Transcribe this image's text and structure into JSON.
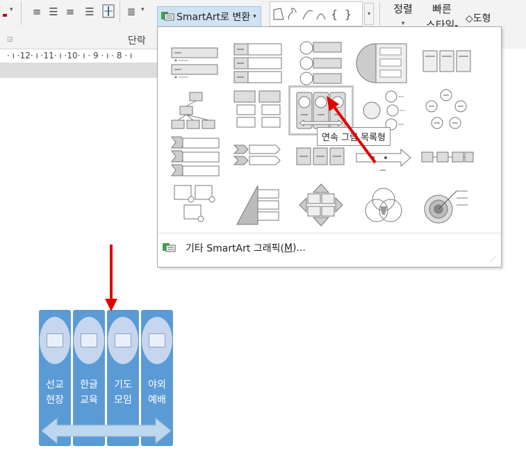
{
  "ribbon": {
    "convert_smartart_label": "SmartArt로 변환",
    "paragraph_group_label": "단락",
    "arrange_label": "정렬",
    "quick_styles_line1": "빠른",
    "quick_styles_line2": "스타일",
    "shape_fill_label": "도형 ",
    "text_direction_label": ""
  },
  "ruler": {
    "ticks": "· ı ·12· ı ·11· ı ·10· ı · 9 · ı · 8 · ı"
  },
  "gallery": {
    "tooltip": "연속 그림 목록형",
    "more_graphics_label": "기타 SmartArt 그래픽(",
    "more_graphics_hotkey": "M",
    "more_graphics_suffix": ")..."
  },
  "graphic": {
    "columns": [
      {
        "line1": "선교",
        "line2": "현장"
      },
      {
        "line1": "한글",
        "line2": "교육"
      },
      {
        "line1": "기도",
        "line2": "모임"
      },
      {
        "line1": "야외",
        "line2": "예배"
      }
    ]
  },
  "colors": {
    "accent_blue": "#5b9bd5",
    "picture_fill": "#c6d6ee",
    "arrow_fill": "#bdd7ee",
    "annotation_red": "#e00000",
    "selection_outline": "#c4c4c4"
  }
}
